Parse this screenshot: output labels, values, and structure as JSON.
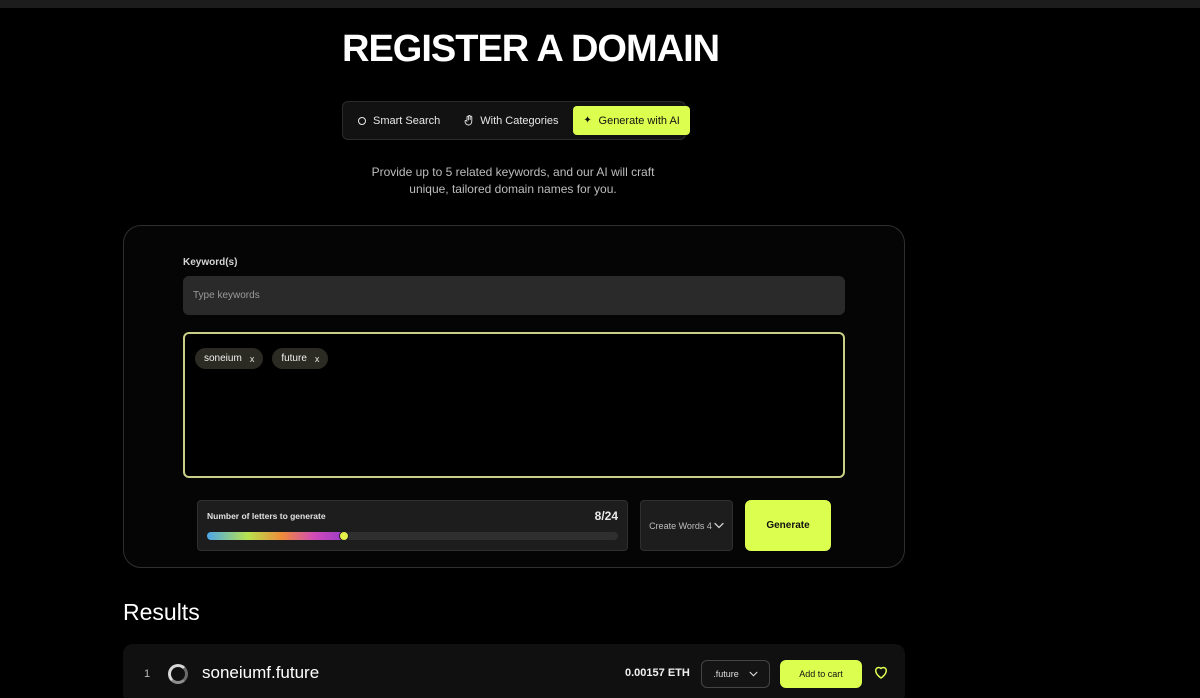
{
  "page": {
    "title": "REGISTER A DOMAIN",
    "subtitle_line1": "Provide up to 5 related keywords, and our AI will craft",
    "subtitle_line2": "unique, tailored domain names for you."
  },
  "tabs": [
    {
      "label": "Smart Search",
      "icon": "ring-icon",
      "active": false
    },
    {
      "label": "With Categories",
      "icon": "hand-icon",
      "active": false
    },
    {
      "label": "Generate with AI",
      "icon": "sparkle-icon",
      "active": true
    }
  ],
  "form": {
    "keyword_label": "Keyword(s)",
    "keyword_placeholder": "Type keywords",
    "keyword_value": "",
    "tags": [
      {
        "label": "soneium",
        "remove": "x"
      },
      {
        "label": "future",
        "remove": "x"
      }
    ],
    "letters_label": "Number of letters to generate",
    "letters_count": "8/24",
    "letters_value": 8,
    "letters_max": 24,
    "words_select": "Create Words 4",
    "generate_label": "Generate"
  },
  "results": {
    "title": "Results",
    "rows": [
      {
        "index": "1",
        "domain": "soneiumf.future",
        "price": "0.00157 ETH",
        "tld": ".future",
        "cart_label": "Add to cart"
      }
    ]
  },
  "colors": {
    "accent": "#dcff4f",
    "tag_border": "#c9cf87"
  }
}
